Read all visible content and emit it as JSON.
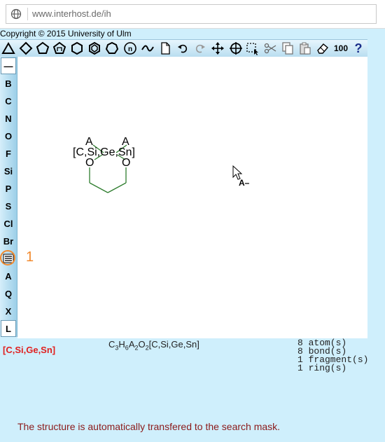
{
  "browser": {
    "url": "www.interhost.de/ih",
    "icon": "globe-icon"
  },
  "copyright": "Copyright © 2015 University of Ulm",
  "toolbar": {
    "items": [
      "triangle-ring-icon",
      "diamond-ring-icon",
      "pentagon-ring-icon",
      "aromatic-pentagon-icon",
      "hexagon-ring-icon",
      "aromatic-hexagon-icon",
      "heptagon-ring-icon",
      "n-ring-icon",
      "chain-icon",
      "new-document-icon",
      "undo-icon",
      "redo-icon",
      "move-icon",
      "center-icon",
      "select-icon",
      "cut-icon",
      "copy-icon",
      "paste-icon",
      "eraser-icon",
      "zoom-value",
      "help-icon"
    ],
    "zoom": "100",
    "help": "?"
  },
  "sidebar": {
    "items": [
      "—",
      "B",
      "C",
      "N",
      "O",
      "F",
      "Si",
      "P",
      "S",
      "Cl",
      "Br",
      "≡",
      "A",
      "Q",
      "X",
      "L"
    ]
  },
  "molecule": {
    "labels": {
      "a1": "A",
      "a2": "A",
      "atomlist": "[C,Si,Ge,Sn]",
      "o1": "O",
      "o2": "O"
    },
    "cursor_label": "A–"
  },
  "status": {
    "atom_list": "[C,Si,Ge,Sn]",
    "formula": {
      "c": "C",
      "c_n": "3",
      "h": "H",
      "h_n": "6",
      "a": "A",
      "a_n": "2",
      "o": "O",
      "o_n": "2",
      "rest": "[C,Si,Ge,Sn]"
    },
    "atoms": "8 atom(s)",
    "bonds": "8 bond(s)",
    "fragments": "1 fragment(s)",
    "rings": "1 ring(s)"
  },
  "message": "The structure is automatically transfered to the search mask.",
  "annotation": {
    "number": "1",
    "color": "#f28a2e"
  },
  "colors": {
    "background": "#cfeffc",
    "status_red": "#e02020",
    "bond_green": "#2e7d2e",
    "message": "#8b1a1a"
  }
}
